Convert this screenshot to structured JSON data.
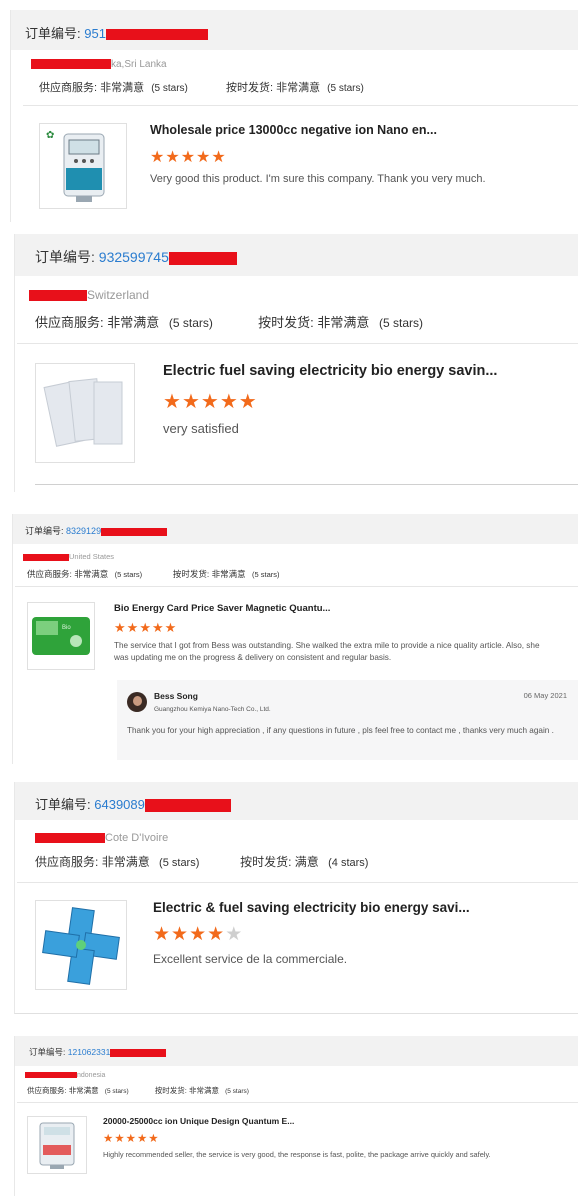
{
  "colors": {
    "link": "#2a7ccf",
    "star": "#f26a1b",
    "redaction": "#e8101a",
    "header_bg": "#f2f2f2"
  },
  "common": {
    "order_label": "订单编号:",
    "supplier_service_label": "供应商服务:",
    "on_time_label": "按时发货:"
  },
  "reviews": [
    {
      "order_prefix": "951",
      "location": "ka,Sri Lanka",
      "supplier_rating": "非常满意",
      "supplier_stars": "(5 stars)",
      "delivery_rating": "非常满意",
      "delivery_stars": "(5 stars)",
      "product_title": "Wholesale price 13000cc negative ion Nano en...",
      "stars": 5,
      "comment": "Very good this product. I'm sure this company. Thank you very much."
    },
    {
      "order_prefix": "932599745",
      "location": "Switzerland",
      "supplier_rating": "非常满意",
      "supplier_stars": "(5 stars)",
      "delivery_rating": "非常满意",
      "delivery_stars": "(5 stars)",
      "product_title": "Electric fuel saving electricity bio energy savin...",
      "stars": 5,
      "comment": "very satisfied"
    },
    {
      "order_prefix": "8329129",
      "location": "United States",
      "supplier_rating": "非常满意",
      "supplier_stars": "(5 stars)",
      "delivery_rating": "非常满意",
      "delivery_stars": "(5 stars)",
      "product_title": "Bio Energy Card Price Saver Magnetic Quantu...",
      "stars": 5,
      "comment": "The service that I got from Bess was outstanding. She walked the extra mile to provide a nice quality article. Also, she was updating me on the progress & delivery on consistent and regular basis.",
      "reply": {
        "name": "Bess Song",
        "company": "Guangzhou Kemiya Nano-Tech Co., Ltd.",
        "date": "06 May 2021",
        "text": "Thank you for your high appreciation , if any questions in future , pls feel free to contact me , thanks very much again ."
      }
    },
    {
      "order_prefix": "6439089",
      "location": "Cote D'Ivoire",
      "supplier_rating": "非常满意",
      "supplier_stars": "(5 stars)",
      "delivery_rating": "满意",
      "delivery_stars": "(4 stars)",
      "product_title": "Electric & fuel saving electricity bio energy savi...",
      "stars": 4,
      "comment": "Excellent service de la commerciale."
    },
    {
      "order_prefix": "121062331",
      "location": "ndonesia",
      "supplier_rating": "非常满意",
      "supplier_stars": "(5 stars)",
      "delivery_rating": "非常满意",
      "delivery_stars": "(5 stars)",
      "product_title": "20000-25000cc ion Unique Design Quantum E...",
      "stars": 5,
      "comment": "Highly recommended seller, the service is very good, the response is fast, polite, the package arrive quickly and safely."
    }
  ]
}
